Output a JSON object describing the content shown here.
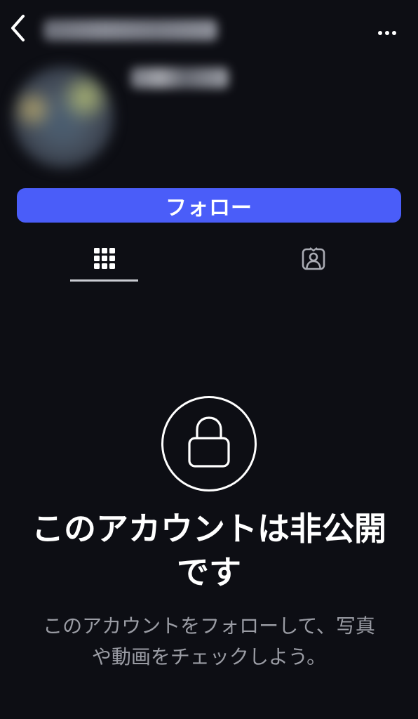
{
  "header": {
    "back_icon": "chevron-left-icon",
    "more_icon": "more-horizontal-icon"
  },
  "profile": {
    "follow_label": "フォロー"
  },
  "tabs": [
    {
      "icon": "grid-icon",
      "selected": true
    },
    {
      "icon": "tagged-person-icon",
      "selected": false
    }
  ],
  "private_notice": {
    "icon": "lock-icon",
    "title": "このアカウントは非公開です",
    "description": "このアカウントをフォローして、写真や動画をチェックしよう。"
  },
  "colors": {
    "background": "#0d0e14",
    "accent": "#4a5df9",
    "secondary_text": "#9a9ca4"
  }
}
